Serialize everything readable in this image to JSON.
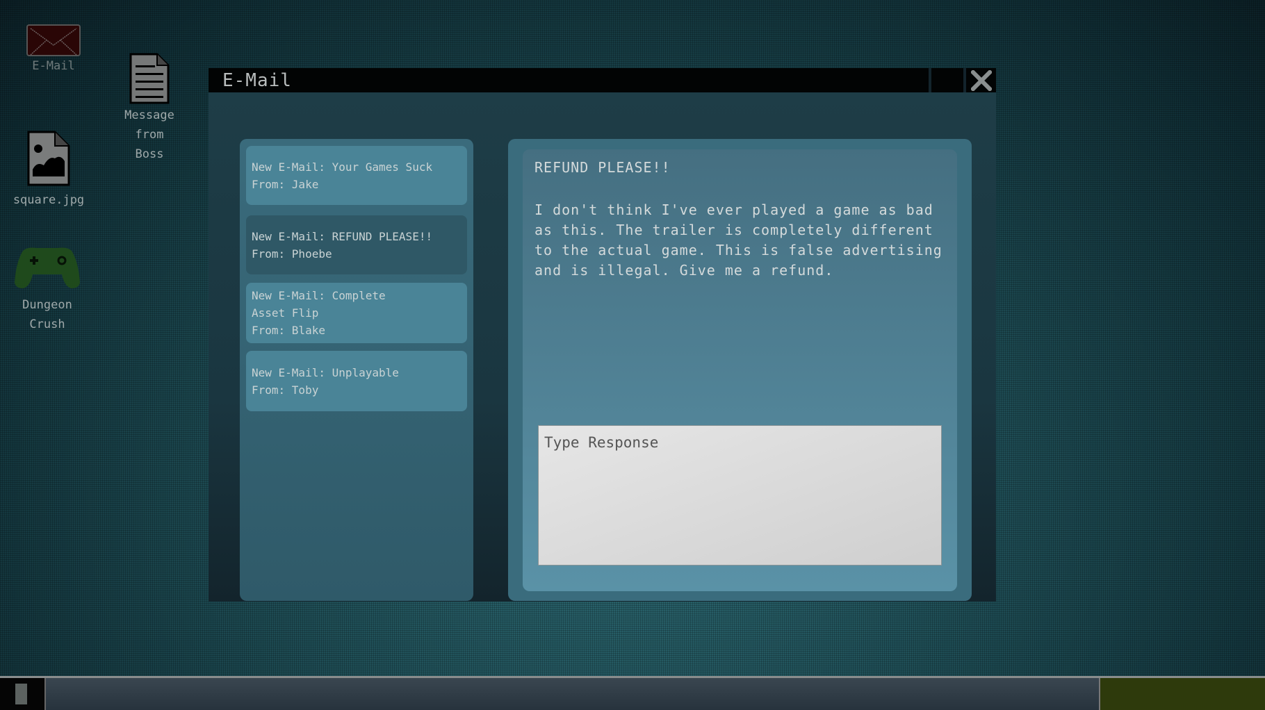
{
  "desktop": {
    "icons": [
      {
        "id": "email",
        "label": "E-Mail",
        "icon": "envelope-icon"
      },
      {
        "id": "boss-message",
        "label": "Message\nfrom\nBoss",
        "icon": "document-icon"
      },
      {
        "id": "square-jpg",
        "label": "square.jpg",
        "icon": "image-file-icon"
      },
      {
        "id": "dungeon-crush",
        "label": "Dungeon\nCrush",
        "icon": "gamepad-icon"
      }
    ]
  },
  "window": {
    "title": "E-Mail",
    "minimize_icon": "minimize-icon",
    "close_icon": "close-icon"
  },
  "mail_list": {
    "items": [
      {
        "subject": "New E-Mail: Your Games Suck",
        "from": "From: Jake",
        "selected": false
      },
      {
        "subject": "New E-Mail: REFUND PLEASE!!",
        "from": "From: Phoebe",
        "selected": true
      },
      {
        "subject": "New E-Mail: Complete Asset Flip",
        "from": "From: Blake",
        "selected": false
      },
      {
        "subject": "New E-Mail: Unplayable",
        "from": "From: Toby",
        "selected": false
      }
    ]
  },
  "message": {
    "title": "REFUND PLEASE!!",
    "body": "I don't think I've ever played a game as bad as this. The trailer is completely different to the actual game. This is false advertising and is illegal. Give me a refund.",
    "response_placeholder": "Type Response",
    "response_value": ""
  },
  "taskbar": {
    "start_icon": "start-icon"
  },
  "colors": {
    "envelope": "#2a0606",
    "gamepad": "#1f4a1c",
    "tray": "#2e3a0c"
  }
}
